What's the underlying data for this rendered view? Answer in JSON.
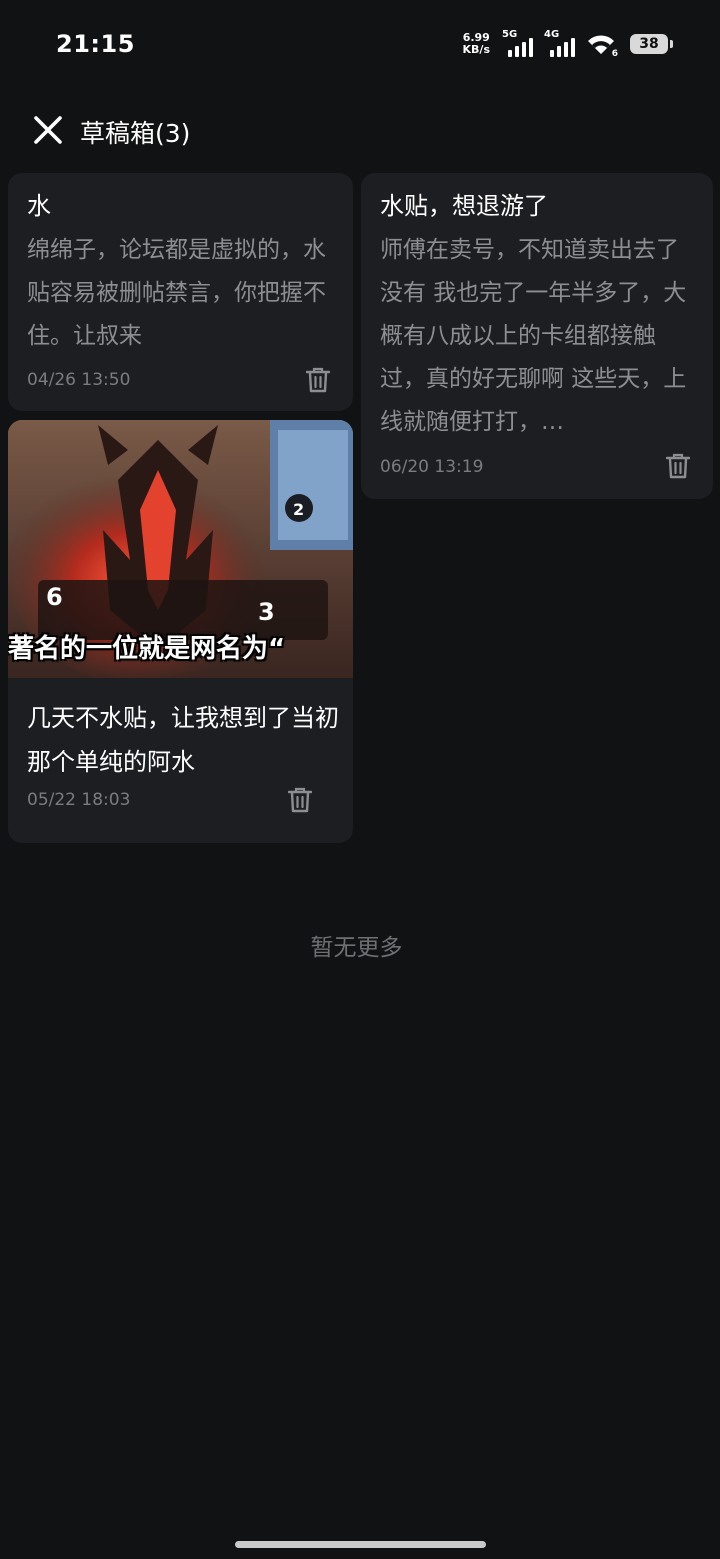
{
  "status_bar": {
    "time": "21:15",
    "net_speed_value": "6.99",
    "net_speed_unit": "KB/s",
    "sim1_type": "5G",
    "sim2_type": "4G",
    "wifi_sub": "6",
    "battery": "38"
  },
  "header": {
    "title": "草稿箱(3)"
  },
  "drafts": [
    {
      "title": "水",
      "body": "绵绵子，论坛都是虚拟的，水贴容易被删帖禁言，你把握不住。让叔来",
      "date": "04/26 13:50"
    },
    {
      "title": "水贴，想退游了",
      "body": "师傅在卖号，不知道卖出去了没有 我也完了一年半多了，大概有八成以上的卡组都接触过，真的好无聊啊 这些天，上线就随便打打，…",
      "date": "06/20 13:19"
    },
    {
      "title": "几天不水贴，让我想到了当初那个单纯的阿水",
      "image_caption": "著名的一位就是网名为“",
      "image_numbers": [
        "6",
        "3",
        "2"
      ],
      "date": "05/22 18:03"
    }
  ],
  "footer": {
    "no_more": "暂无更多"
  },
  "colors": {
    "background": "#111213",
    "card": "#1d1e22",
    "title_text": "#ffffff",
    "body_text": "#8d8e92",
    "meta_text": "#7b7c80"
  }
}
